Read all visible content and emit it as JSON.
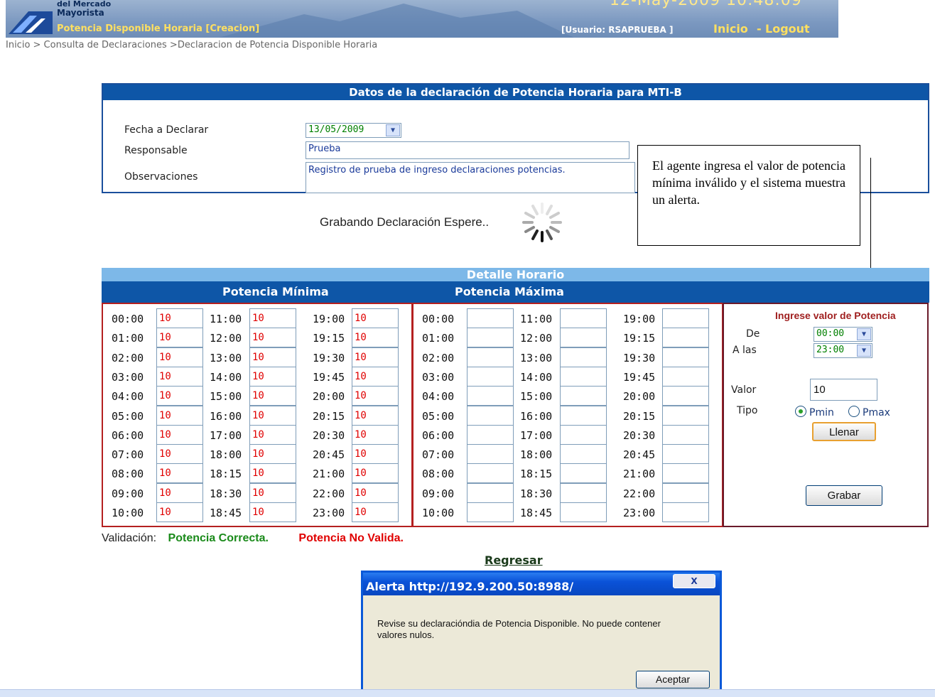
{
  "header": {
    "org_line1": "del Mercado",
    "org_line2": "Mayorista",
    "page_title": "Potencia Disponible Horaria [Creacion]",
    "datetime": "12-May-2009 10:48:09",
    "user": "[Usuario: RSAPRUEBA ]",
    "link_inicio": "Inicio",
    "separator": "-",
    "link_logout": "Logout"
  },
  "breadcrumb": "Inicio > Consulta de Declaraciones >Declaracion de Potencia Disponible Horaria",
  "form": {
    "title": "Datos de la declaración de Potencia Horaria para MTI-B",
    "fecha_label": "Fecha a Declarar",
    "fecha_value": "13/05/2009",
    "responsable_label": "Responsable",
    "responsable_value": "Prueba",
    "observaciones_label": "Observaciones",
    "observaciones_value": "Registro de prueba de ingreso declaraciones potencias."
  },
  "callout": "El agente ingresa el valor de potencia mínima inválido y el sistema muestra un alerta.",
  "saving": "Grabando Declaración Espere..",
  "detalle": {
    "title": "Detalle Horario",
    "min_header": "Potencia Mínima",
    "max_header": "Potencia Máxima"
  },
  "columns": [
    [
      "00:00",
      "01:00",
      "02:00",
      "03:00",
      "04:00",
      "05:00",
      "06:00",
      "07:00",
      "08:00",
      "09:00",
      "10:00"
    ],
    [
      "11:00",
      "12:00",
      "13:00",
      "14:00",
      "15:00",
      "16:00",
      "17:00",
      "18:00",
      "18:15",
      "18:30",
      "18:45"
    ],
    [
      "19:00",
      "19:15",
      "19:30",
      "19:45",
      "20:00",
      "20:15",
      "20:30",
      "20:45",
      "21:00",
      "22:00",
      "23:00"
    ]
  ],
  "min_value": "10",
  "max_value": "",
  "ingreso": {
    "title": "Ingrese valor de Potencia",
    "de_label": "De",
    "de_value": "00:00",
    "alas_label": "A las",
    "alas_value": "23:00",
    "valor_label": "Valor",
    "valor_value": "10",
    "tipo_label": "Tipo",
    "pmin_label": "Pmin",
    "pmax_label": "Pmax",
    "llenar_label": "Llenar",
    "grabar_label": "Grabar"
  },
  "validacion": {
    "label": "Validación:",
    "ok": "Potencia Correcta.",
    "bad": "Potencia No Valida.",
    "ok_color": "#1a8a1a",
    "bad_color": "#e00000"
  },
  "regresar": "Regresar",
  "alert": {
    "title": "Alerta http://192.9.200.50:8988/",
    "close": "X",
    "message": "Revise su declaracióndia de Potencia Disponible. No puede contener valores nulos.",
    "ok_label": "Aceptar"
  }
}
